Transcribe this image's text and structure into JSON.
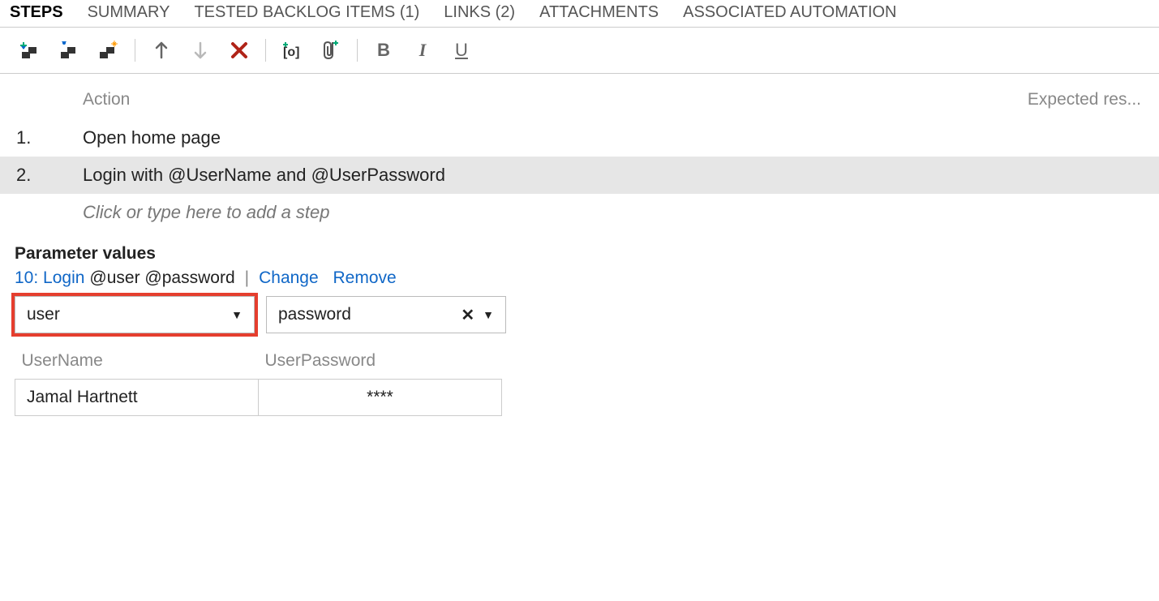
{
  "tabs": {
    "steps": "STEPS",
    "summary": "SUMMARY",
    "backlog": "TESTED BACKLOG ITEMS (1)",
    "links": "LINKS (2)",
    "attachments": "ATTACHMENTS",
    "automation": "ASSOCIATED AUTOMATION"
  },
  "toolbar": {
    "bold": "B",
    "italic": "I",
    "underline": "U"
  },
  "grid": {
    "action_header": "Action",
    "expected_header": "Expected res...",
    "steps": [
      {
        "num": "1.",
        "action": "Open home page"
      },
      {
        "num": "2.",
        "action": "Login with  @UserName and  @UserPassword"
      }
    ],
    "add_placeholder": "Click or type here to add a step"
  },
  "params": {
    "title": "Parameter values",
    "set_link": "10: Login",
    "set_suffix": "@user @password",
    "change": "Change",
    "remove": "Remove",
    "dd1": "user",
    "dd2": "password",
    "col1": "UserName",
    "col2": "UserPassword",
    "val1": "Jamal Hartnett",
    "val2": "****"
  }
}
